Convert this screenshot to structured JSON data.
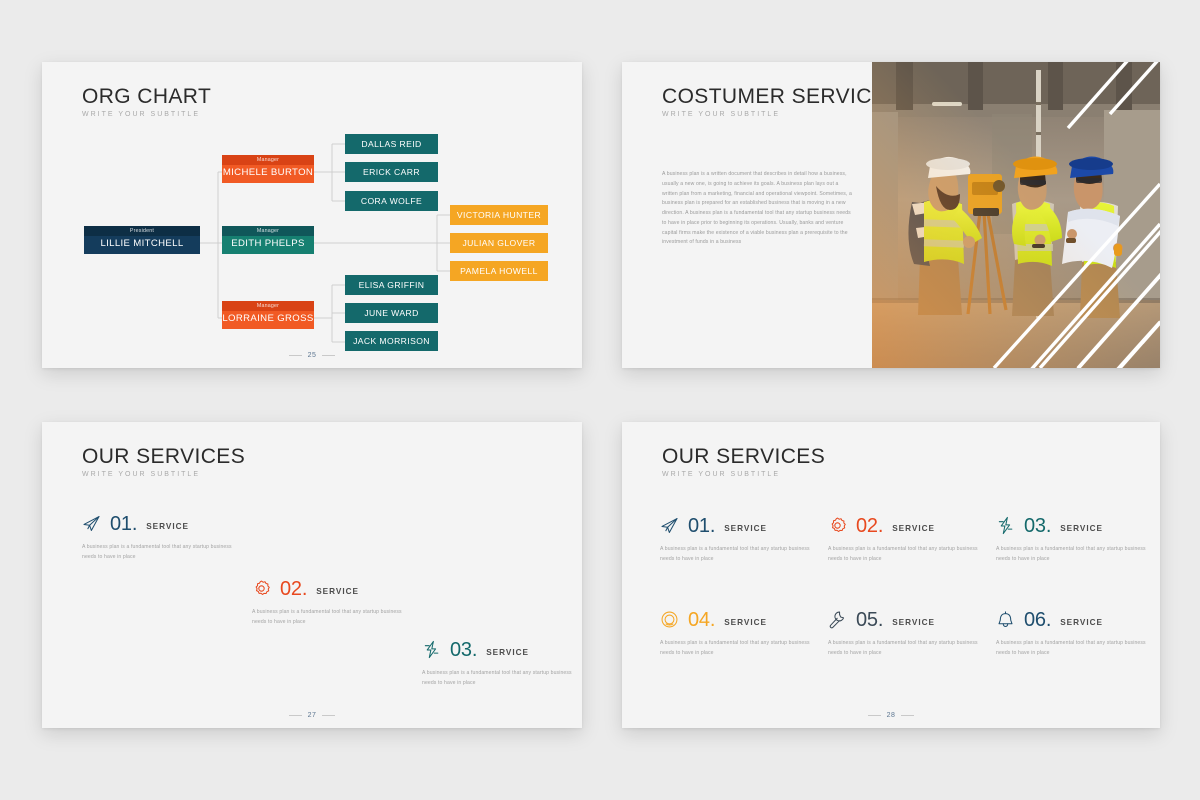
{
  "theme": {
    "canvas_bg": "#ebebeb",
    "slide_bg": "#f4f4f4",
    "navy": "#143c5c",
    "navy_dark": "#0d2e45",
    "teal": "#168071",
    "teal_dark": "#10575a",
    "teal_leaf": "#14696b",
    "orange_red": "#f15a24",
    "orange_red_dark": "#d94315",
    "amber": "#f5a623",
    "title_color": "#2b2b2b",
    "subtitle_color": "#a9a9a9",
    "body_color": "#9a9a9a",
    "connector_color": "#cfcfcf"
  },
  "slides": [
    {
      "id": "org-chart",
      "title": "ORG CHART",
      "subtitle": "WRITE YOUR SUBTITLE",
      "page_number": "25",
      "org_chart": {
        "president": {
          "role": "President",
          "name": "LILLIE MITCHELL"
        },
        "managers": [
          {
            "role": "Manager",
            "name": "MICHELE BURTON",
            "color": "orange_red"
          },
          {
            "role": "Manager",
            "name": "EDITH PHELPS",
            "color": "teal"
          },
          {
            "role": "Manager",
            "name": "LORRAINE GROSS",
            "color": "orange_red"
          }
        ],
        "burton_reports": [
          "DALLAS REID",
          "ERICK CARR",
          "CORA WOLFE"
        ],
        "phelps_reports": [
          "VICTORIA HUNTER",
          "JULIAN GLOVER",
          "PAMELA HOWELL"
        ],
        "gross_reports": [
          "ELISA GRIFFIN",
          "JUNE WARD",
          "JACK MORRISON"
        ]
      }
    },
    {
      "id": "customer-services",
      "title": "COSTUMER SERVICES",
      "subtitle": "WRITE YOUR SUBTITLE",
      "page_number": "",
      "body": "A business plan is a written document that describes in detail how a business, usually a new one, is going to achieve its goals. A business plan lays out a written plan from a marketing, financial and operational viewpoint. Sometimes, a business plan is prepared for an established business that is moving in a new direction. A business plan is a fundamental tool that any startup business needs to have in place prior to beginning its operations. Usually, banks and venture capital firms make the existence of a viable business plan a prerequisite to the investment of funds in a business",
      "photo_alt": "three construction surveyors in hi-vis vests and hard hats with a theodolite"
    },
    {
      "id": "our-services-3",
      "title": "OUR SERVICES",
      "subtitle": "WRITE YOUR SUBTITLE",
      "page_number": "27",
      "services": [
        {
          "num": "01.",
          "word": "SERVICE",
          "icon": "paper-plane-icon",
          "color": "#1f4e6e",
          "desc": "A business plan is a fundamental tool that any startup business needs to have in place"
        },
        {
          "num": "02.",
          "word": "SERVICE",
          "icon": "gear-icon",
          "color": "#e8491f",
          "desc": "A business plan is a fundamental tool that any startup business needs to have in place"
        },
        {
          "num": "03.",
          "word": "SERVICE",
          "icon": "lightning-bolt-icon",
          "color": "#14696b",
          "desc": "A business plan is a fundamental tool that any startup business needs to have in place"
        }
      ]
    },
    {
      "id": "our-services-6",
      "title": "OUR SERVICES",
      "subtitle": "WRITE YOUR SUBTITLE",
      "page_number": "28",
      "services": [
        {
          "num": "01.",
          "word": "SERVICE",
          "icon": "paper-plane-icon",
          "color": "#1f4e6e",
          "desc": "A business plan is a fundamental tool that any startup business needs to have in place"
        },
        {
          "num": "02.",
          "word": "SERVICE",
          "icon": "gear-icon",
          "color": "#e8491f",
          "desc": "A business plan is a fundamental tool that any startup business needs to have in place"
        },
        {
          "num": "03.",
          "word": "SERVICE",
          "icon": "lightning-bolt-icon",
          "color": "#14696b",
          "desc": "A business plan is a fundamental tool that any startup business needs to have in place"
        },
        {
          "num": "04.",
          "word": "SERVICE",
          "icon": "target-circle-icon",
          "color": "#f5a623",
          "desc": "A business plan is a fundamental tool that any startup business needs to have in place"
        },
        {
          "num": "05.",
          "word": "SERVICE",
          "icon": "wrench-icon",
          "color": "#3b4a57",
          "desc": "A business plan is a fundamental tool that any startup business needs to have in place"
        },
        {
          "num": "06.",
          "word": "SERVICE",
          "icon": "bell-icon",
          "color": "#1f4e6e",
          "desc": "A business plan is a fundamental tool that any startup business needs to have in place"
        }
      ]
    }
  ]
}
